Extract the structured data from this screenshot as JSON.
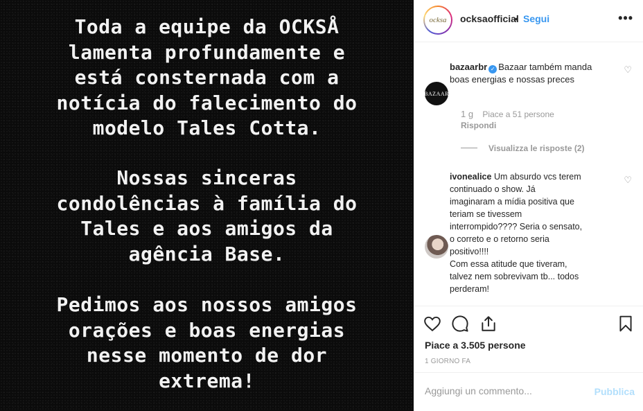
{
  "story": {
    "paragraphs": [
      [
        "Toda a equipe da OCKSÅ",
        "lamenta profundamente e",
        "está consternada com a",
        "notícia do falecimento do",
        "modelo Tales Cotta."
      ],
      [
        "Nossas sinceras",
        "condolências à família do",
        "Tales e aos amigos da",
        "agência Base."
      ],
      [
        "Pedimos aos nossos amigos",
        "orações e boas energias",
        "nesse momento de dor",
        "extrema!"
      ]
    ]
  },
  "header": {
    "avatar_text": "ocksa",
    "username": "ocksaofficial",
    "separator": "•",
    "follow_label": "Segui",
    "more_icon": "•••"
  },
  "comments": [
    {
      "avatar_text": "BAZAAR",
      "username": "bazaarbr",
      "verified": true,
      "text": "Bazaar também manda boas energias e nossas preces",
      "time": "1 g",
      "likes": "Piace a 51 persone",
      "reply_label": "Rispondi",
      "view_replies": "Visualizza le risposte (2)"
    },
    {
      "username": "ivonealice",
      "text_lines": [
        "Um absurdo vcs terem",
        "continuado o show. Já",
        "imaginaram a mídia positiva que",
        "teriam se tivessem",
        "interrompido???? Seria o sensato,",
        "o correto e o retorno seria",
        "positivo!!!!",
        "Com essa atitude que tiveram,",
        "talvez nem sobrevivam tb... todos",
        "perderam!"
      ]
    }
  ],
  "actions": {
    "like_icon": "heart-outline-icon",
    "comment_icon": "comment-bubble-icon",
    "share_icon": "share-upload-icon",
    "save_icon": "bookmark-icon",
    "likes_text": "Piace a 3.505 persone",
    "time_ago": "1 GIORNO FA"
  },
  "add_comment": {
    "placeholder": "Aggiungi un commento...",
    "publish_label": "Pubblica"
  },
  "colors": {
    "accent": "#3897f0",
    "publish_disabled": "#b2dffc",
    "media_bg": "#0b0b0b"
  }
}
